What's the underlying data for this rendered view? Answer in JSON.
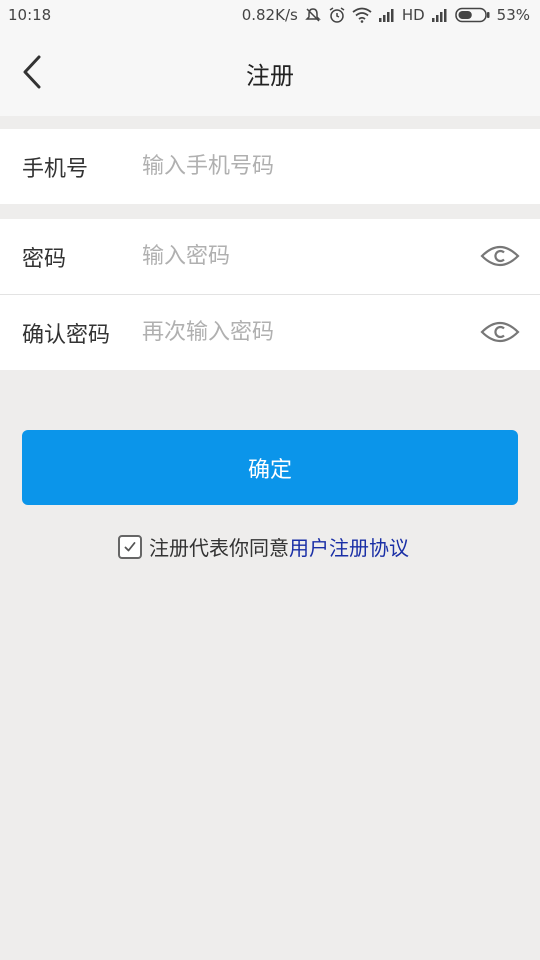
{
  "status_bar": {
    "time": "10:18",
    "speed": "0.82K/s",
    "network": "HD",
    "battery": "53%",
    "battery_level": 0.53,
    "icons": [
      "mute-icon",
      "alarm-icon",
      "wifi-icon",
      "signal-icon",
      "battery-icon"
    ]
  },
  "header": {
    "back_icon": "chevron-left-icon",
    "title": "注册"
  },
  "form": {
    "phone": {
      "label": "手机号",
      "placeholder": "输入手机号码",
      "value": ""
    },
    "password": {
      "label": "密码",
      "placeholder": "输入密码",
      "value": "",
      "toggle_icon": "eye-icon"
    },
    "confirm_password": {
      "label": "确认密码",
      "placeholder": "再次输入密码",
      "value": "",
      "toggle_icon": "eye-icon"
    }
  },
  "confirm_button": {
    "label": "确定",
    "color": "#0b95ea"
  },
  "agreement": {
    "checked": true,
    "text": "注册代表你同意",
    "link": "用户注册协议",
    "link_color": "#1a2fa6"
  }
}
